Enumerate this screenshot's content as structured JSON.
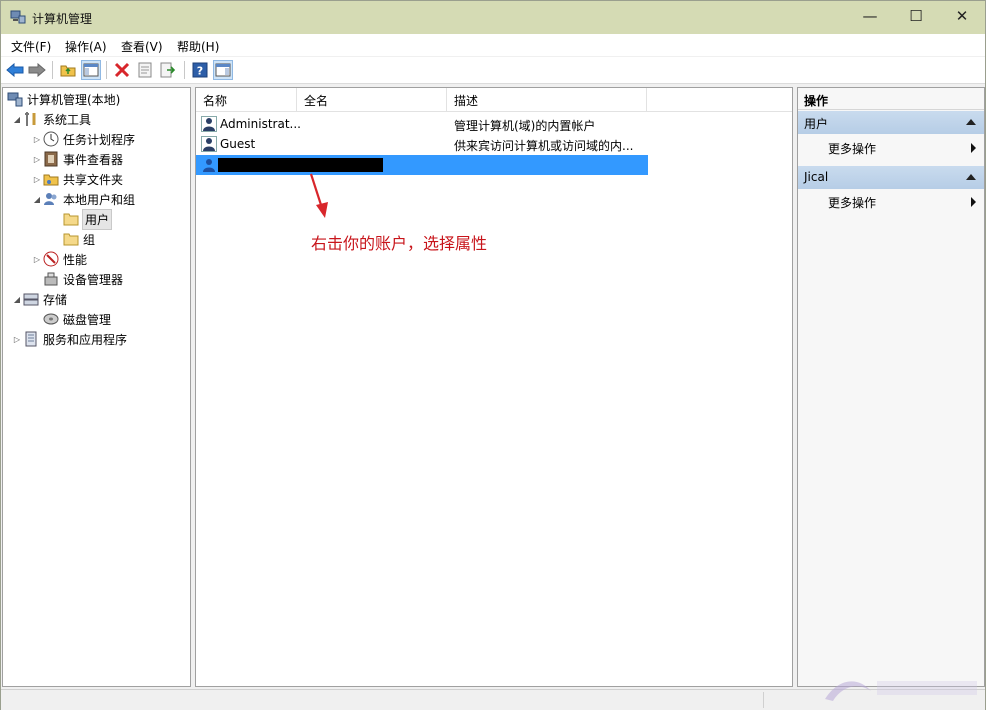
{
  "window": {
    "title": "计算机管理",
    "min_glyph": "—",
    "max_glyph": "☐",
    "close_glyph": "✕"
  },
  "menu": {
    "items": [
      {
        "label": "文件(F)"
      },
      {
        "label": "操作(A)"
      },
      {
        "label": "查看(V)"
      },
      {
        "label": "帮助(H)"
      }
    ]
  },
  "toolbar": {
    "buttons": [
      {
        "icon": "back-arrow-icon"
      },
      {
        "icon": "forward-arrow-icon"
      },
      {
        "icon": "up-folder-icon"
      },
      {
        "icon": "show-tree-icon"
      },
      {
        "icon": "delete-icon"
      },
      {
        "icon": "properties-icon"
      },
      {
        "icon": "export-list-icon"
      },
      {
        "icon": "help-icon"
      },
      {
        "icon": "show-action-pane-icon"
      }
    ]
  },
  "tree": {
    "nodes": [
      {
        "label": "计算机管理(本地)",
        "icon": "computer-management-icon",
        "arrow": ""
      },
      {
        "label": "系统工具",
        "icon": "system-tools-icon",
        "arrow": "◢"
      },
      {
        "label": "任务计划程序",
        "icon": "task-scheduler-icon",
        "arrow": "▷"
      },
      {
        "label": "事件查看器",
        "icon": "event-viewer-icon",
        "arrow": "▷"
      },
      {
        "label": "共享文件夹",
        "icon": "shared-folders-icon",
        "arrow": "▷"
      },
      {
        "label": "本地用户和组",
        "icon": "local-users-groups-icon",
        "arrow": "◢"
      },
      {
        "label": "用户",
        "icon": "folder-icon",
        "arrow": ""
      },
      {
        "label": "组",
        "icon": "folder-icon",
        "arrow": ""
      },
      {
        "label": "性能",
        "icon": "performance-icon",
        "arrow": "▷"
      },
      {
        "label": "设备管理器",
        "icon": "device-manager-icon",
        "arrow": ""
      },
      {
        "label": "存储",
        "icon": "storage-icon",
        "arrow": "◢"
      },
      {
        "label": "磁盘管理",
        "icon": "disk-management-icon",
        "arrow": ""
      },
      {
        "label": "服务和应用程序",
        "icon": "services-apps-icon",
        "arrow": "▷"
      }
    ]
  },
  "list": {
    "columns": [
      {
        "label": "名称"
      },
      {
        "label": "全名"
      },
      {
        "label": "描述"
      }
    ],
    "rows": [
      {
        "name": "Administrat...",
        "fullname": "",
        "description": "管理计算机(域)的内置帐户"
      },
      {
        "name": "Guest",
        "fullname": "",
        "description": "供来宾访问计算机或访问域的内..."
      },
      {
        "name": "",
        "fullname": "",
        "description": "",
        "selected": true
      }
    ],
    "annotation": "右击你的账户，选择属性"
  },
  "actions": {
    "title": "操作",
    "sections": [
      {
        "label": "用户",
        "item": "更多操作"
      },
      {
        "label": "Jical",
        "item": "更多操作"
      }
    ]
  },
  "colors": {
    "titlebar": "#d5dbb4",
    "selection": "#3399ff",
    "annotation": "#c8151b"
  }
}
